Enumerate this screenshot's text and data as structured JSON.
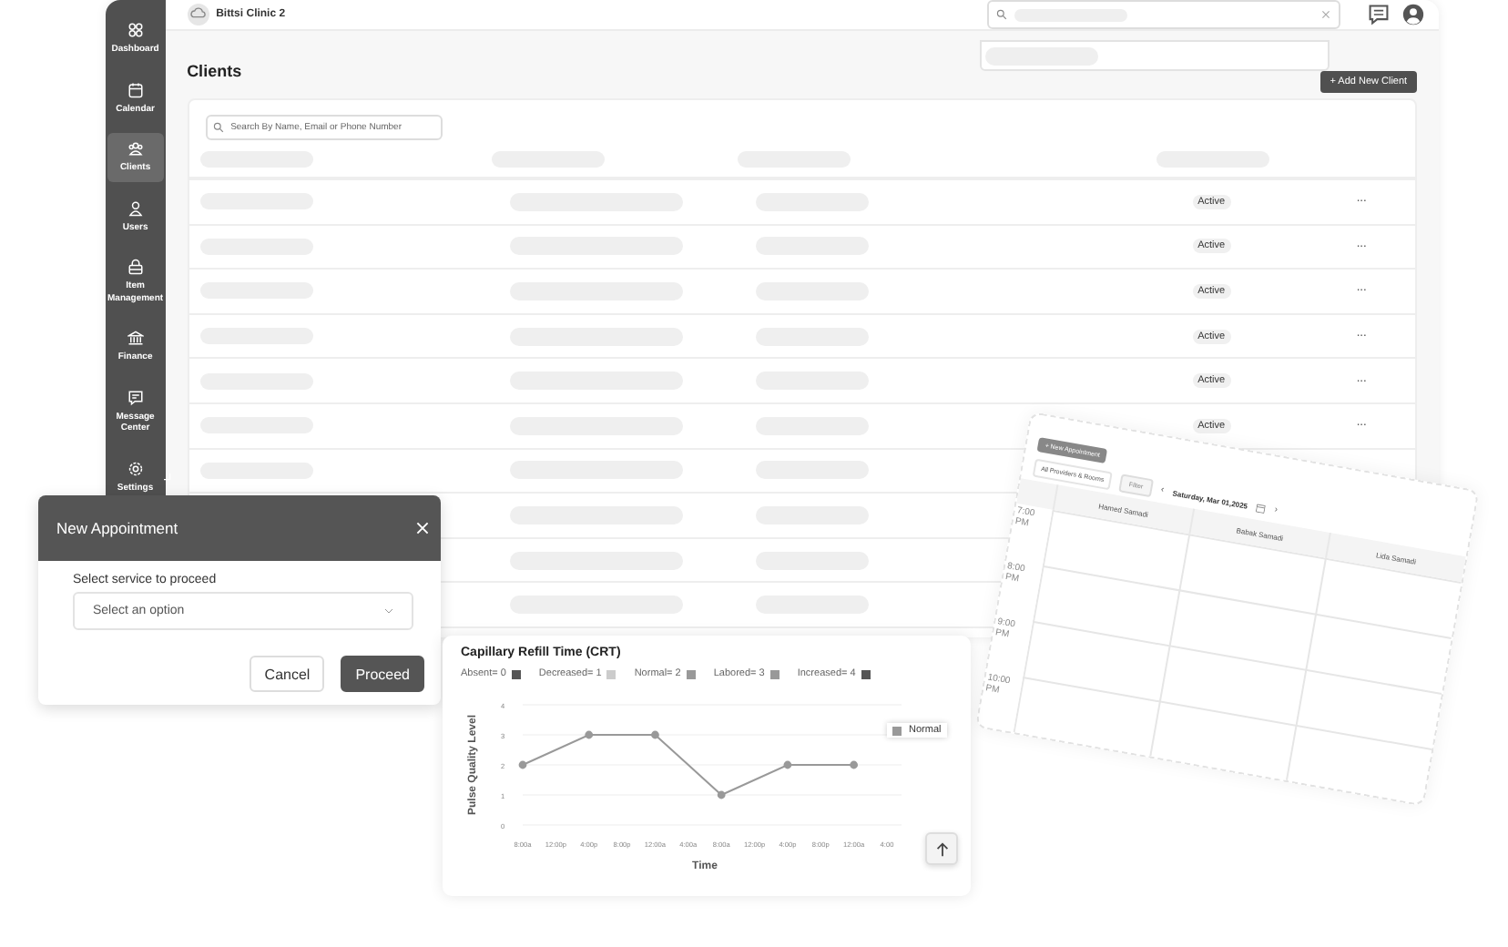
{
  "sidebar": {
    "items": [
      {
        "label": "Dashboard",
        "selected": false
      },
      {
        "label": "Calendar",
        "selected": false
      },
      {
        "label": "Clients",
        "selected": true
      },
      {
        "label": "Users",
        "selected": false
      },
      {
        "label": "Item Management",
        "selected": false
      },
      {
        "label": "Finance",
        "selected": false
      },
      {
        "label": "Message Center",
        "selected": false
      },
      {
        "label": "Settings",
        "selected": false
      }
    ]
  },
  "header": {
    "clinic_name": "Bittsi Clinic 2"
  },
  "page": {
    "title": "Clients",
    "add_button": "+ Add New Client",
    "search": {
      "placeholder": "Search By Name, Email or Phone Number"
    }
  },
  "table": {
    "rows": [
      {
        "status": "Active",
        "menu": "···"
      },
      {
        "status": "Active",
        "menu": "···"
      },
      {
        "status": "Active",
        "menu": "···"
      },
      {
        "status": "Active",
        "menu": "···"
      },
      {
        "status": "Active",
        "menu": "···"
      },
      {
        "status": "Active",
        "menu": "···"
      }
    ]
  },
  "modal": {
    "title": "New Appointment",
    "field_label": "Select service to proceed",
    "select": {
      "placeholder": "Select an option"
    },
    "buttons": [
      {
        "label": "Cancel",
        "kind": "secondary"
      },
      {
        "label": "Proceed",
        "kind": "primary"
      }
    ]
  },
  "chart_card": {
    "title": "Capillary Refill Time (CRT)",
    "levels": [
      {
        "label": "Absent= 0",
        "color": "#555555"
      },
      {
        "label": "Decreased= 1",
        "color": "#cccccc"
      },
      {
        "label": "Normal= 2",
        "color": "#999999"
      },
      {
        "label": "Labored= 3",
        "color": "#999999"
      },
      {
        "label": "Increased= 4",
        "color": "#555555"
      }
    ],
    "chart_data": {
      "type": "line",
      "xlabel": "Time",
      "ylabel": "Pulse Quality Level",
      "categories": [
        "8:00a",
        "12:00p",
        "4:00p",
        "8:00p",
        "12:00a",
        "4:00a",
        "8:00a",
        "12:00p",
        "4:00p",
        "8:00p",
        "12:00a",
        "4:00"
      ],
      "grid": true,
      "series": [
        {
          "name": "Normal",
          "color": "#999999",
          "marker": "circle",
          "values": [
            2,
            null,
            3,
            null,
            3,
            null,
            1,
            null,
            2,
            null,
            2,
            null
          ]
        }
      ],
      "ylim": [
        0,
        4
      ],
      "yticks": [
        0,
        1,
        2,
        3,
        4
      ]
    }
  },
  "calendar": {
    "new_button": "+ New Appointment",
    "provider_filter": "All Providers & Rooms",
    "filter_button": "Filter",
    "prev": "‹",
    "date": "Saturday, Mar 01,2025",
    "next": "›",
    "columns": [
      "Hamed Samadi",
      "Babak Samadi",
      "Lida Samadi"
    ],
    "times": [
      "7:00 PM",
      "8:00 PM",
      "9:00 PM",
      "10:00 PM"
    ]
  }
}
